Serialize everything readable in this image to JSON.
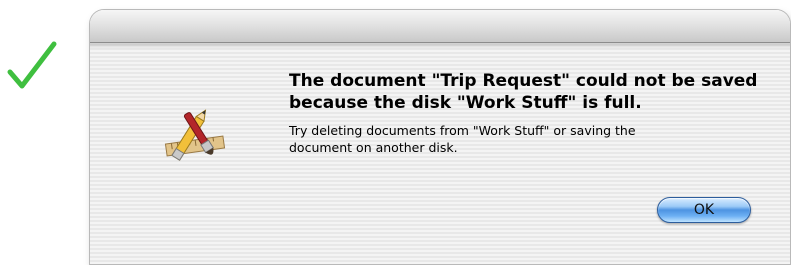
{
  "annotation": {
    "checkmark_icon": "checkmark-icon",
    "checkmark_color": "#3fbf3f"
  },
  "dialog": {
    "app_icon": "pencil-brush-ruler-icon",
    "message_title": "The document \"Trip Request\" could not be saved because the disk \"Work Stuff\" is full.",
    "message_detail": "Try deleting documents from \"Work Stuff\" or saving the document on another disk.",
    "ok_label": "OK",
    "ok_button_color": "#5aa0ec"
  }
}
